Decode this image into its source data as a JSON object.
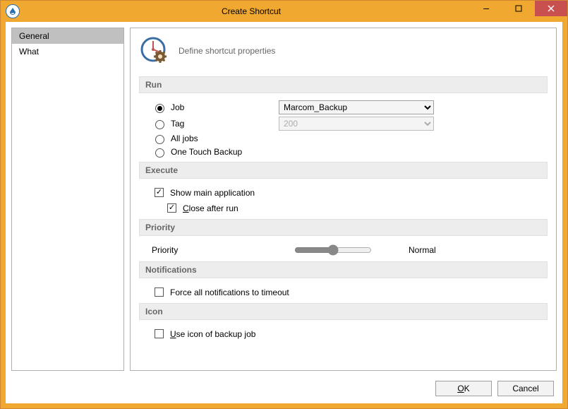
{
  "window": {
    "title": "Create Shortcut"
  },
  "sidebar": {
    "items": [
      {
        "label": "General",
        "selected": true
      },
      {
        "label": "What",
        "selected": false
      }
    ]
  },
  "header": {
    "description": "Define shortcut properties"
  },
  "run": {
    "title": "Run",
    "selected": "job",
    "options": {
      "job": "Job",
      "tag": "Tag",
      "all": "All jobs",
      "onetouch": "One Touch Backup"
    },
    "job_value": "Marcom_Backup",
    "tag_value": "200"
  },
  "execute": {
    "title": "Execute",
    "show_main_label": "Show main application",
    "show_main_checked": true,
    "close_after_label": "Close after run",
    "close_after_hotkey": "C",
    "close_after_checked": true
  },
  "priority": {
    "title": "Priority",
    "label": "Priority",
    "value_text": "Normal",
    "value": 2,
    "min": 0,
    "max": 4
  },
  "notifications": {
    "title": "Notifications",
    "force_timeout_label": "Force all notifications to timeout",
    "force_timeout_checked": false
  },
  "icon": {
    "title": "Icon",
    "use_icon_label": "Use icon of backup job",
    "use_icon_hotkey": "U",
    "use_icon_checked": false
  },
  "buttons": {
    "ok": "OK",
    "ok_hotkey": "O",
    "cancel": "Cancel"
  }
}
